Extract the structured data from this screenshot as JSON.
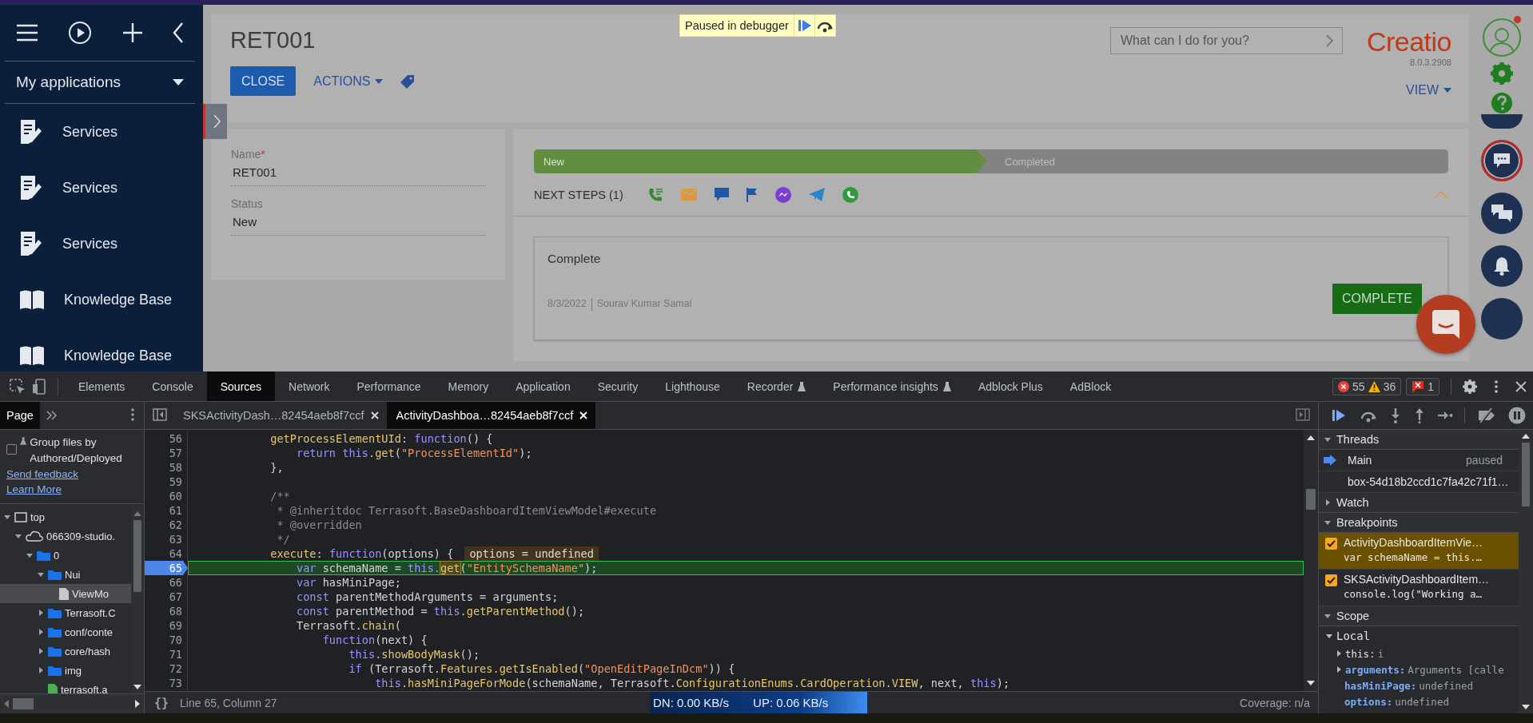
{
  "debugger_banner": {
    "text": "Paused in debugger"
  },
  "sidebar": {
    "menu": "My applications",
    "items": [
      {
        "label": "Services",
        "kind": "section"
      },
      {
        "label": "Services",
        "kind": "section"
      },
      {
        "label": "Services",
        "kind": "section"
      },
      {
        "label": "Knowledge Base",
        "kind": "knowledge"
      },
      {
        "label": "Knowledge Base",
        "kind": "knowledge"
      }
    ]
  },
  "header": {
    "title": "RET001",
    "buttons": [
      {
        "label": "CLOSE",
        "kind": "primary"
      },
      {
        "label": "ACTIONS",
        "kind": "dropdown"
      }
    ],
    "search": {
      "placeholder": "What can I do for you?"
    },
    "logo": "Creatio",
    "version": "8.0.3.2908",
    "view": "VIEW"
  },
  "record": {
    "required_mark": "*",
    "fields": [
      {
        "label": "Name",
        "required": true,
        "value": "RET001"
      },
      {
        "label": "Status",
        "required": false,
        "value": "New"
      }
    ]
  },
  "stages": [
    {
      "label": "New",
      "done": true
    },
    {
      "label": "Completed",
      "done": false
    }
  ],
  "next_steps": {
    "title": "NEXT STEPS (1)",
    "task": {
      "title": "Complete",
      "date": "8/3/2022",
      "author": "Sourav Kumar Samal",
      "button": "COMPLETE"
    }
  },
  "devtools": {
    "tabs": [
      {
        "label": "Elements",
        "selected": false,
        "experimental": false
      },
      {
        "label": "Console",
        "selected": false,
        "experimental": false
      },
      {
        "label": "Sources",
        "selected": true,
        "experimental": false
      },
      {
        "label": "Network",
        "selected": false,
        "experimental": false
      },
      {
        "label": "Performance",
        "selected": false,
        "experimental": false
      },
      {
        "label": "Memory",
        "selected": false,
        "experimental": false
      },
      {
        "label": "Application",
        "selected": false,
        "experimental": false
      },
      {
        "label": "Security",
        "selected": false,
        "experimental": false
      },
      {
        "label": "Lighthouse",
        "selected": false,
        "experimental": false
      },
      {
        "label": "Recorder",
        "selected": false,
        "experimental": true
      },
      {
        "label": "Performance insights",
        "selected": false,
        "experimental": true
      },
      {
        "label": "Adblock Plus",
        "selected": false,
        "experimental": false
      },
      {
        "label": "AdBlock",
        "selected": false,
        "experimental": false
      }
    ],
    "counts": {
      "errors": "55",
      "warnings": "36",
      "issues": "1"
    },
    "navigator": {
      "tab": "Page",
      "group_label": "Group files by Authored/Deployed",
      "group_checked": false,
      "links": [
        "Send feedback",
        "Learn More"
      ],
      "tree": [
        {
          "label": "top",
          "kind": "frame",
          "expanded": true,
          "selected": false,
          "children": [
            {
              "label": "066309-studio.",
              "kind": "domain",
              "expanded": true,
              "selected": false,
              "children": [
                {
                  "label": "0",
                  "kind": "folder",
                  "expanded": true,
                  "selected": false,
                  "children": [
                    {
                      "label": "Nui",
                      "kind": "folder",
                      "expanded": true,
                      "selected": false,
                      "children": [
                        {
                          "label": "ViewMo",
                          "kind": "file",
                          "selected": true
                        }
                      ]
                    },
                    {
                      "label": "Terrasoft.C",
                      "kind": "folder",
                      "expanded": false,
                      "selected": false
                    },
                    {
                      "label": "conf/conte",
                      "kind": "folder",
                      "expanded": false,
                      "selected": false
                    },
                    {
                      "label": "core/hash",
                      "kind": "folder",
                      "expanded": false,
                      "selected": false
                    },
                    {
                      "label": "img",
                      "kind": "folder",
                      "expanded": false,
                      "selected": false
                    },
                    {
                      "label": "terrasoft.a",
                      "kind": "script",
                      "selected": false
                    }
                  ]
                }
              ]
            }
          ]
        }
      ]
    },
    "editor": {
      "files": [
        {
          "name": "SKSActivityDash…82454aeb8f7ccf",
          "selected": false
        },
        {
          "name": "ActivityDashboa…82454aeb8f7ccf",
          "selected": true
        }
      ],
      "lines": [
        {
          "n": "56",
          "breakpoint": false,
          "current": false,
          "tokens": [
            {
              "kind": "method",
              "text": "            getProcessElementUId"
            },
            {
              "kind": "plain",
              "text": ": "
            },
            {
              "kind": "keyword",
              "text": "function"
            },
            {
              "kind": "plain",
              "text": "() {"
            }
          ]
        },
        {
          "n": "57",
          "breakpoint": false,
          "current": false,
          "tokens": [
            {
              "kind": "keyword",
              "text": "                return this"
            },
            {
              "kind": "method",
              "text": ".get"
            },
            {
              "kind": "plain",
              "text": "("
            },
            {
              "kind": "string",
              "text": "\"ProcessElementId\""
            },
            {
              "kind": "plain",
              "text": ");"
            }
          ]
        },
        {
          "n": "58",
          "breakpoint": false,
          "current": false,
          "tokens": [
            {
              "kind": "plain",
              "text": "            },"
            }
          ]
        },
        {
          "n": "59",
          "breakpoint": false,
          "current": false
        },
        {
          "n": "60",
          "breakpoint": false,
          "current": false,
          "tokens": [
            {
              "kind": "comment",
              "text": "            /**"
            }
          ]
        },
        {
          "n": "61",
          "breakpoint": false,
          "current": false,
          "tokens": [
            {
              "kind": "comment",
              "text": "             * @inheritdoc Terrasoft.BaseDashboardItemViewModel#execute"
            }
          ]
        },
        {
          "n": "62",
          "breakpoint": false,
          "current": false,
          "tokens": [
            {
              "kind": "comment",
              "text": "             * @overridden"
            }
          ]
        },
        {
          "n": "63",
          "breakpoint": false,
          "current": false,
          "tokens": [
            {
              "kind": "comment",
              "text": "             */"
            }
          ]
        },
        {
          "n": "64",
          "breakpoint": false,
          "current": false,
          "inline_value": "options = undefined",
          "tokens": [
            {
              "kind": "method",
              "text": "            execute"
            },
            {
              "kind": "plain",
              "text": ": "
            },
            {
              "kind": "keyword",
              "text": "function"
            },
            {
              "kind": "plain",
              "text": "(options) {"
            }
          ]
        },
        {
          "n": "65",
          "breakpoint": true,
          "current": true,
          "tokens": [
            {
              "kind": "keyword",
              "text": "                var"
            },
            {
              "kind": "plain",
              "text": " schemaName = "
            },
            {
              "kind": "keyword",
              "text": "this."
            },
            {
              "kind": "hit",
              "text": "get"
            },
            {
              "kind": "plain",
              "text": "("
            },
            {
              "kind": "string",
              "text": "\"EntitySchemaName\""
            },
            {
              "kind": "plain",
              "text": ");"
            }
          ]
        },
        {
          "n": "66",
          "breakpoint": false,
          "current": false,
          "tokens": [
            {
              "kind": "keyword",
              "text": "                var"
            },
            {
              "kind": "plain",
              "text": " hasMiniPage;"
            }
          ]
        },
        {
          "n": "67",
          "breakpoint": false,
          "current": false,
          "tokens": [
            {
              "kind": "keyword",
              "text": "                const"
            },
            {
              "kind": "plain",
              "text": " parentMethodArguments = arguments;"
            }
          ]
        },
        {
          "n": "68",
          "breakpoint": false,
          "current": false,
          "tokens": [
            {
              "kind": "keyword",
              "text": "                const"
            },
            {
              "kind": "plain",
              "text": " parentMethod = "
            },
            {
              "kind": "keyword",
              "text": "this"
            },
            {
              "kind": "method",
              "text": ".getParentMethod"
            },
            {
              "kind": "plain",
              "text": "();"
            }
          ]
        },
        {
          "n": "69",
          "breakpoint": false,
          "current": false,
          "tokens": [
            {
              "kind": "plain",
              "text": "                Terrasoft."
            },
            {
              "kind": "method",
              "text": "chain"
            },
            {
              "kind": "plain",
              "text": "("
            }
          ]
        },
        {
          "n": "70",
          "breakpoint": false,
          "current": false,
          "tokens": [
            {
              "kind": "keyword",
              "text": "                    function"
            },
            {
              "kind": "plain",
              "text": "(next) {"
            }
          ]
        },
        {
          "n": "71",
          "breakpoint": false,
          "current": false,
          "tokens": [
            {
              "kind": "keyword",
              "text": "                        this"
            },
            {
              "kind": "method",
              "text": ".showBodyMask"
            },
            {
              "kind": "plain",
              "text": "();"
            }
          ]
        },
        {
          "n": "72",
          "breakpoint": false,
          "current": false,
          "tokens": [
            {
              "kind": "keyword",
              "text": "                        if"
            },
            {
              "kind": "plain",
              "text": " (Terrasoft."
            },
            {
              "kind": "method",
              "text": "Features.getIsEnabled"
            },
            {
              "kind": "plain",
              "text": "("
            },
            {
              "kind": "string",
              "text": "\"OpenEditPageInDcm\""
            },
            {
              "kind": "plain",
              "text": ")) {"
            }
          ]
        },
        {
          "n": "73",
          "breakpoint": false,
          "current": false,
          "tokens": [
            {
              "kind": "keyword",
              "text": "                            this"
            },
            {
              "kind": "method",
              "text": ".hasMiniPageForMode"
            },
            {
              "kind": "plain",
              "text": "(schemaName, Terrasoft."
            },
            {
              "kind": "method",
              "text": "ConfigurationEnums.CardOperation.VIEW"
            },
            {
              "kind": "plain",
              "text": ", next, "
            },
            {
              "kind": "keyword",
              "text": "this"
            },
            {
              "kind": "plain",
              "text": ");"
            }
          ]
        }
      ],
      "pretty_print": "{}",
      "status": "Line 65, Column 27",
      "coverage": "Coverage: n/a"
    },
    "debugger": {
      "threads": {
        "title": "Threads",
        "expanded": true,
        "items": [
          {
            "name": "Main",
            "status": "paused",
            "current": true
          },
          {
            "name": "box-54d18b2ccd1c7fa42c71f1…",
            "current": false
          }
        ]
      },
      "watch": {
        "title": "Watch",
        "expanded": false
      },
      "breakpoints": {
        "title": "Breakpoints",
        "expanded": true,
        "items": [
          {
            "file": "ActivityDashboardItemVie…",
            "code": "var schemaName = this.…",
            "checked": true,
            "hit": true
          },
          {
            "file": "SKSActivityDashboardItem…",
            "code": "console.log(\"Working a…",
            "checked": true,
            "hit": false
          }
        ]
      },
      "scope": {
        "title": "Scope",
        "expanded": true,
        "local": "Local",
        "local_expanded": true,
        "vars": [
          {
            "name": "this:",
            "value": "i",
            "expandable": true,
            "bold": false
          },
          {
            "name": "arguments:",
            "value": "Arguments [calle",
            "expandable": true,
            "bold": true
          },
          {
            "name": "hasMiniPage:",
            "value": "undefined",
            "expandable": false,
            "bold": true
          },
          {
            "name": "options:",
            "value": "undefined",
            "expandable": false,
            "bold": true
          }
        ]
      }
    }
  },
  "net_meter": {
    "down": "DN: 0.00 KB/s",
    "up": "UP: 0.06 KB/s"
  }
}
